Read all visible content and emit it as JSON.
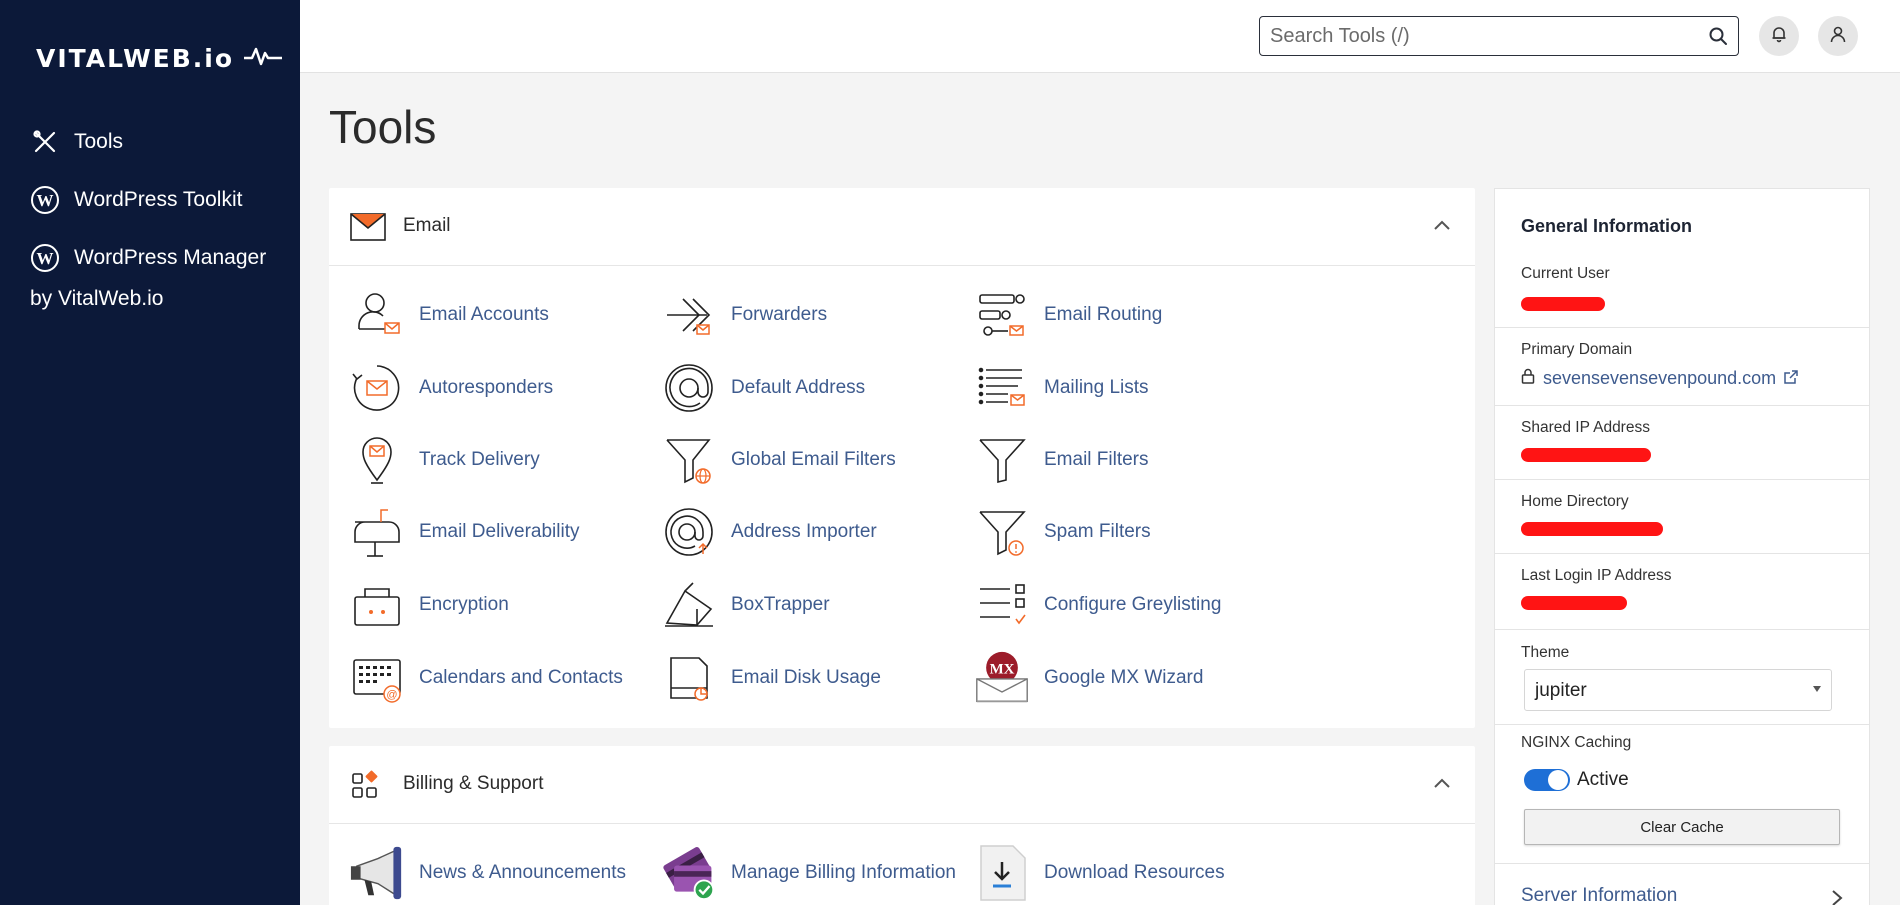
{
  "sidebar": {
    "logo": "VITALWEB.io",
    "items": [
      {
        "label": "Tools"
      },
      {
        "label": "WordPress Toolkit"
      },
      {
        "label": "WordPress Manager"
      }
    ],
    "items_suffix": "by VitalWeb.io"
  },
  "header": {
    "search_placeholder": "Search Tools (/)"
  },
  "page": {
    "title": "Tools"
  },
  "email_panel": {
    "title": "Email",
    "tools": [
      {
        "label": "Email Accounts",
        "icon": "email-accounts-icon"
      },
      {
        "label": "Forwarders",
        "icon": "forwarders-icon"
      },
      {
        "label": "Email Routing",
        "icon": "email-routing-icon"
      },
      {
        "label": "Autoresponders",
        "icon": "autoresponders-icon"
      },
      {
        "label": "Default Address",
        "icon": "default-address-icon"
      },
      {
        "label": "Mailing Lists",
        "icon": "mailing-lists-icon"
      },
      {
        "label": "Track Delivery",
        "icon": "track-delivery-icon"
      },
      {
        "label": "Global Email Filters",
        "icon": "global-email-filters-icon"
      },
      {
        "label": "Email Filters",
        "icon": "email-filters-icon"
      },
      {
        "label": "Email Deliverability",
        "icon": "email-deliverability-icon"
      },
      {
        "label": "Address Importer",
        "icon": "address-importer-icon"
      },
      {
        "label": "Spam Filters",
        "icon": "spam-filters-icon"
      },
      {
        "label": "Encryption",
        "icon": "encryption-icon"
      },
      {
        "label": "BoxTrapper",
        "icon": "boxtrapper-icon"
      },
      {
        "label": "Configure Greylisting",
        "icon": "greylisting-icon"
      },
      {
        "label": "Calendars and Contacts",
        "icon": "calendars-icon"
      },
      {
        "label": "Email Disk Usage",
        "icon": "disk-usage-icon"
      },
      {
        "label": "Google MX Wizard",
        "icon": "google-mx-icon"
      }
    ],
    "mx_badge": "MX"
  },
  "billing_panel": {
    "title": "Billing & Support",
    "tools": [
      {
        "label": "News & Announcements",
        "icon": "megaphone-icon"
      },
      {
        "label": "Manage Billing Information",
        "icon": "credit-card-icon"
      },
      {
        "label": "Download Resources",
        "icon": "download-icon"
      }
    ]
  },
  "general_info": {
    "title": "General Information",
    "current_user_label": "Current User",
    "primary_domain_label": "Primary Domain",
    "primary_domain": "sevensevensevenpound.com",
    "shared_ip_label": "Shared IP Address",
    "home_dir_label": "Home Directory",
    "last_login_label": "Last Login IP Address",
    "theme_label": "Theme",
    "theme_value": "jupiter",
    "nginx_label": "NGINX Caching",
    "nginx_status": "Active",
    "clear_cache": "Clear Cache",
    "server_info": "Server Information"
  },
  "colors": {
    "sidebar_bg": "#0c1939",
    "link": "#3e5b8e",
    "accent_orange": "#f26b2a",
    "toggle_on": "#1e6fd6",
    "redaction": "#ff1414"
  }
}
